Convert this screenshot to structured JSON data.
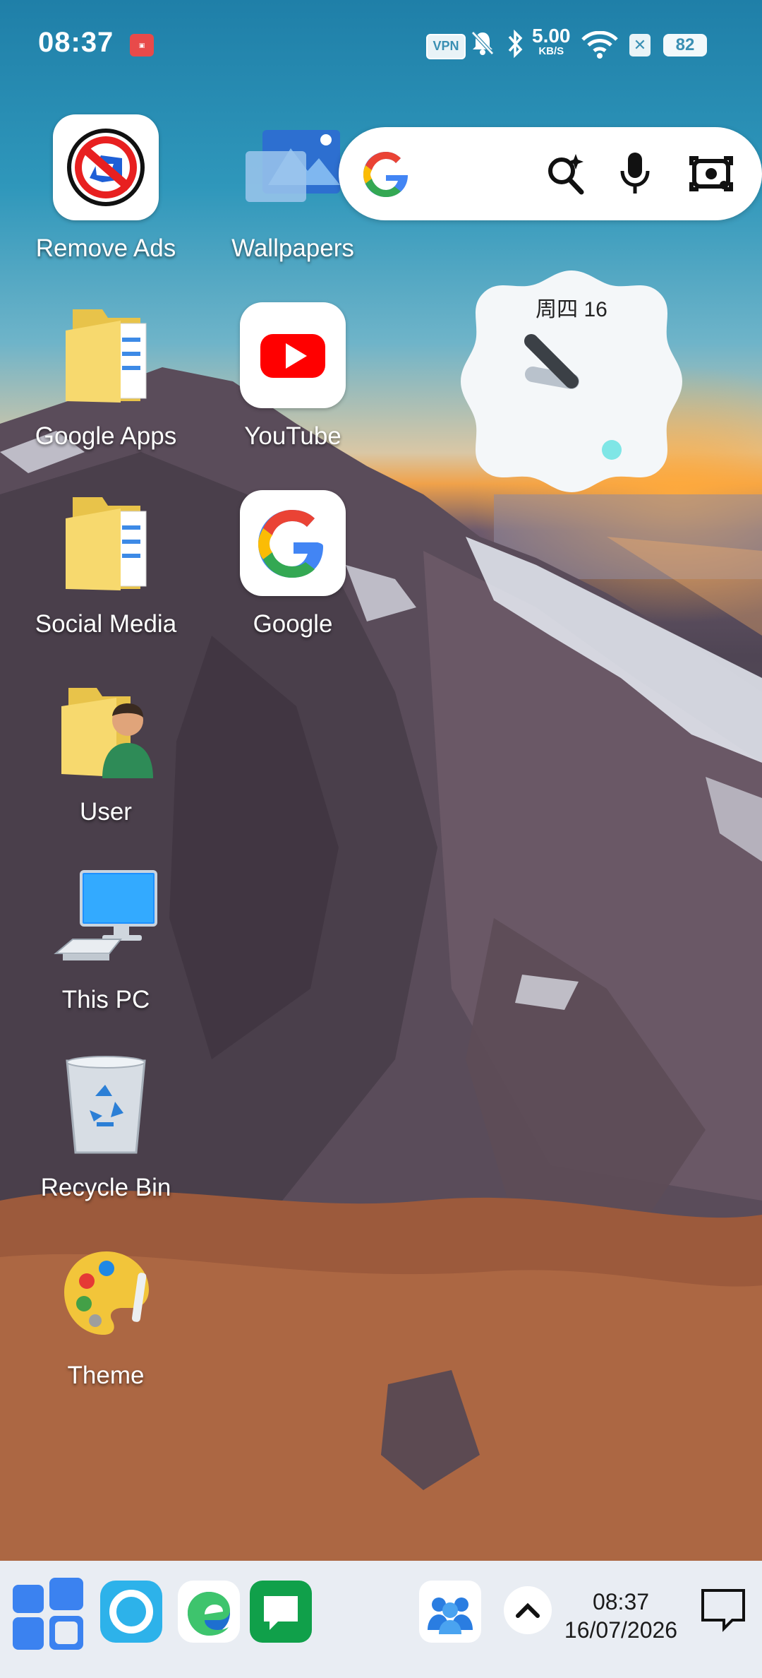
{
  "status_bar": {
    "time": "08:37",
    "vpn_label": "VPN",
    "net_speed_value": "5.00",
    "net_speed_unit": "KB/S",
    "battery": "82"
  },
  "desktop": {
    "icons": [
      {
        "label": "Remove Ads",
        "icon": "remove-ads-icon"
      },
      {
        "label": "Wallpapers",
        "icon": "wallpapers-icon"
      },
      {
        "label": "Google Apps",
        "icon": "folder-icon"
      },
      {
        "label": "YouTube",
        "icon": "youtube-icon"
      },
      {
        "label": "Social Media",
        "icon": "folder-icon"
      },
      {
        "label": "Google",
        "icon": "google-icon"
      },
      {
        "label": "User",
        "icon": "user-folder-icon"
      },
      {
        "label": "This PC",
        "icon": "computer-icon"
      },
      {
        "label": "Recycle Bin",
        "icon": "recycle-bin-icon"
      },
      {
        "label": "Theme",
        "icon": "palette-icon"
      }
    ]
  },
  "clock_widget": {
    "date": "周四 16"
  },
  "taskbar": {
    "time": "08:37",
    "date": "16/07/2026"
  },
  "colors": {
    "taskbar_bg": "#e9edf3",
    "accent": "#2f7fe8",
    "youtube_red": "#ff0000"
  }
}
